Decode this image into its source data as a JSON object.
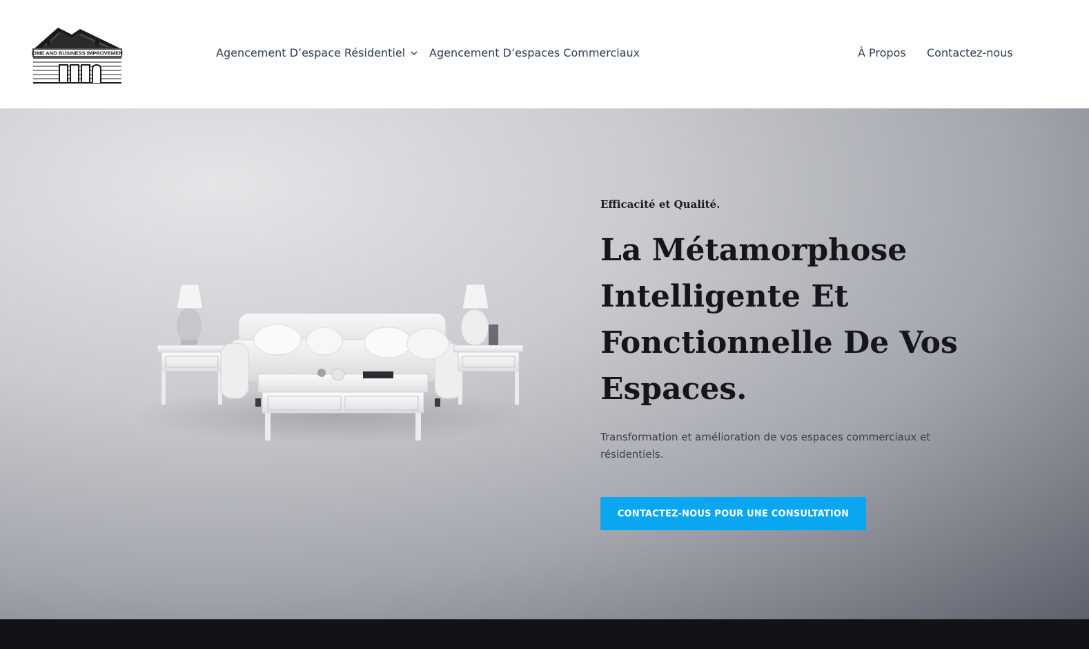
{
  "header": {
    "logo": {
      "text": "HOME AND BUSINESS IMPROVEMENT",
      "icon": "house-logo-icon"
    },
    "nav": {
      "residential": "Agencement D’espace Résidentiel",
      "commercial": "Agencement D’espaces Commerciaux",
      "about": "À Propos",
      "contact": "Contactez-nous"
    }
  },
  "hero": {
    "eyebrow": "Efficacité et Qualité.",
    "headline": "La Métamorphose Intelligente Et Fonctionnelle De Vos Espaces.",
    "subtext": "Transformation et amélioration de vos espaces commerciaux et résidentiels.",
    "cta_label": "CONTACTEZ-NOUS POUR UNE CONSULTATION",
    "image": "white-living-room-furniture-image"
  },
  "colors": {
    "nav_text": "#2c3e50",
    "cta": "#0aa6f0",
    "footer": "#111318",
    "headline": "#15161b"
  }
}
